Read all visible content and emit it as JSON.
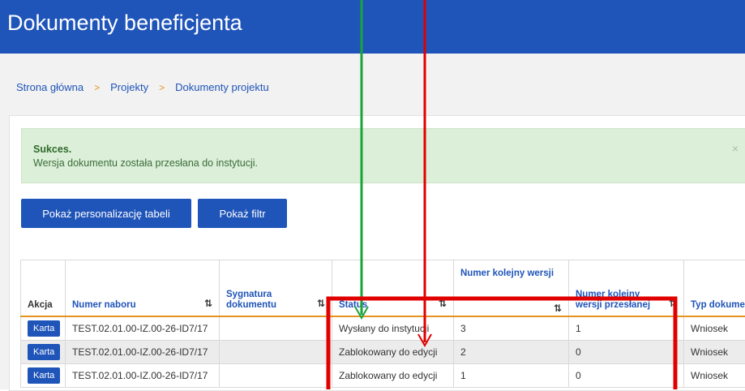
{
  "header": {
    "title": "Dokumenty beneficjenta"
  },
  "breadcrumb": [
    {
      "label": "Strona główna"
    },
    {
      "label": "Projekty"
    },
    {
      "label": "Dokumenty projektu"
    }
  ],
  "breadcrumb_separator": ">",
  "alert": {
    "title": "Sukces.",
    "message": "Wersja dokumentu została przesłana do instytucji.",
    "close": "×"
  },
  "buttons": {
    "personalize": "Pokaż personalizację tabeli",
    "filter": "Pokaż filtr"
  },
  "table": {
    "sort_icon": "⇅",
    "columns": [
      "Akcja",
      "Numer naboru",
      "Sygnatura dokumentu",
      "Status",
      "Numer kolejny wersji",
      "Numer kolejny wersji przesłanej",
      "Typ dokume"
    ],
    "action_label": "Karta",
    "rows": [
      {
        "numer_naboru": "TEST.02.01.00-IZ.00-26-ID7/17",
        "sygnatura": "",
        "status": "Wysłany do instytucji",
        "wersja": "3",
        "wersja_przeslana": "1",
        "typ": "Wniosek"
      },
      {
        "numer_naboru": "TEST.02.01.00-IZ.00-26-ID7/17",
        "sygnatura": "",
        "status": "Zablokowany do edycji",
        "wersja": "2",
        "wersja_przeslana": "0",
        "typ": "Wniosek"
      },
      {
        "numer_naboru": "TEST.02.01.00-IZ.00-26-ID7/17",
        "sygnatura": "",
        "status": "Zablokowany do edycji",
        "wersja": "1",
        "wersja_przeslana": "0",
        "typ": "Wniosek"
      }
    ]
  },
  "colors": {
    "brand_blue": "#1f54b9",
    "accent_orange": "#e3931e",
    "success_bg": "#dcefd8",
    "annotation_red": "#e00000",
    "annotation_green": "#19a33a"
  }
}
